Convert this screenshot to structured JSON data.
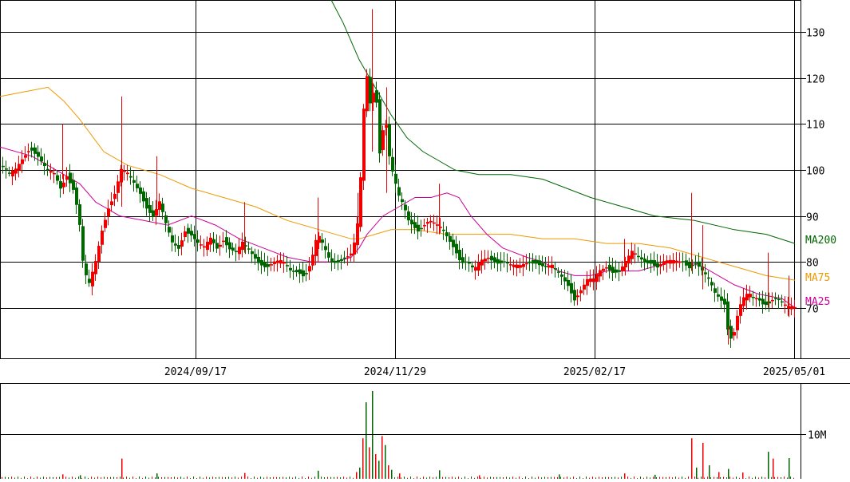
{
  "chart_data": {
    "type": "candlestick",
    "x_labels": [
      "2024/09/17",
      "2024/11/29",
      "2025/02/17",
      "2025/05/01"
    ],
    "y_ticks": [
      70,
      80,
      90,
      100,
      110,
      120,
      130
    ],
    "ylim": [
      59,
      137
    ],
    "volume_ticks": [
      {
        "value": 10000000,
        "label": "10M"
      }
    ],
    "volume_max": 19500000,
    "colors": {
      "up": "#ee0000",
      "down": "#006600",
      "ma25": "#cc0099",
      "ma75": "#ee9900",
      "ma200": "#006600",
      "grid": "#000000"
    },
    "legend": [
      {
        "name": "MA200",
        "color": "#006600"
      },
      {
        "name": "MA75",
        "color": "#ee9900"
      },
      {
        "name": "MA25",
        "color": "#cc0099"
      }
    ],
    "price_path": [
      [
        0,
        101
      ],
      [
        10,
        99
      ],
      [
        18,
        100
      ],
      [
        28,
        103
      ],
      [
        36,
        105
      ],
      [
        46,
        103
      ],
      [
        56,
        100
      ],
      [
        66,
        99
      ],
      [
        74,
        96
      ],
      [
        82,
        99
      ],
      [
        90,
        96
      ],
      [
        97,
        90
      ],
      [
        103,
        78
      ],
      [
        110,
        75
      ],
      [
        118,
        80
      ],
      [
        126,
        87
      ],
      [
        134,
        92
      ],
      [
        142,
        95
      ],
      [
        150,
        100
      ],
      [
        158,
        99
      ],
      [
        166,
        97
      ],
      [
        174,
        95
      ],
      [
        182,
        92
      ],
      [
        190,
        90
      ],
      [
        198,
        93
      ],
      [
        206,
        88
      ],
      [
        214,
        84
      ],
      [
        222,
        83
      ],
      [
        230,
        87
      ],
      [
        238,
        86
      ],
      [
        246,
        84
      ],
      [
        254,
        83
      ],
      [
        262,
        85
      ],
      [
        270,
        83
      ],
      [
        278,
        85
      ],
      [
        286,
        83
      ],
      [
        294,
        82
      ],
      [
        302,
        84
      ],
      [
        312,
        82
      ],
      [
        322,
        80
      ],
      [
        332,
        79
      ],
      [
        342,
        80
      ],
      [
        352,
        80
      ],
      [
        362,
        78
      ],
      [
        372,
        78
      ],
      [
        380,
        77
      ],
      [
        388,
        80
      ],
      [
        396,
        86
      ],
      [
        404,
        83
      ],
      [
        412,
        80
      ],
      [
        420,
        80
      ],
      [
        430,
        81
      ],
      [
        440,
        82
      ],
      [
        448,
        90
      ],
      [
        453,
        110
      ],
      [
        457,
        122
      ],
      [
        461,
        115
      ],
      [
        465,
        113
      ],
      [
        468,
        125
      ],
      [
        472,
        105
      ],
      [
        476,
        103
      ],
      [
        480,
        115
      ],
      [
        484,
        105
      ],
      [
        488,
        101
      ],
      [
        492,
        98
      ],
      [
        498,
        94
      ],
      [
        504,
        92
      ],
      [
        510,
        89
      ],
      [
        516,
        88
      ],
      [
        522,
        87
      ],
      [
        528,
        88
      ],
      [
        536,
        89
      ],
      [
        544,
        88
      ],
      [
        552,
        87
      ],
      [
        560,
        85
      ],
      [
        568,
        83
      ],
      [
        576,
        80
      ],
      [
        584,
        80
      ],
      [
        592,
        78
      ],
      [
        600,
        80
      ],
      [
        610,
        81
      ],
      [
        620,
        80
      ],
      [
        630,
        80
      ],
      [
        640,
        79
      ],
      [
        650,
        79
      ],
      [
        660,
        80
      ],
      [
        670,
        80
      ],
      [
        680,
        79
      ],
      [
        690,
        79
      ],
      [
        700,
        77
      ],
      [
        710,
        75
      ],
      [
        718,
        72
      ],
      [
        726,
        74
      ],
      [
        734,
        76
      ],
      [
        742,
        76
      ],
      [
        750,
        78
      ],
      [
        758,
        79
      ],
      [
        766,
        78
      ],
      [
        774,
        78
      ],
      [
        782,
        80
      ],
      [
        790,
        82
      ],
      [
        798,
        81
      ],
      [
        806,
        80
      ],
      [
        814,
        80
      ],
      [
        822,
        79
      ],
      [
        830,
        80
      ],
      [
        838,
        80
      ],
      [
        846,
        80
      ],
      [
        854,
        80
      ],
      [
        862,
        79
      ],
      [
        870,
        80
      ],
      [
        878,
        78
      ],
      [
        886,
        76
      ],
      [
        894,
        73
      ],
      [
        900,
        72
      ],
      [
        906,
        71
      ],
      [
        912,
        63
      ],
      [
        918,
        65
      ],
      [
        924,
        70
      ],
      [
        930,
        72
      ],
      [
        936,
        73
      ],
      [
        942,
        72
      ],
      [
        948,
        72
      ],
      [
        954,
        71
      ],
      [
        960,
        71
      ],
      [
        966,
        72
      ],
      [
        972,
        72
      ],
      [
        978,
        71
      ],
      [
        984,
        70
      ],
      [
        990,
        70
      ],
      [
        996,
        70
      ]
    ],
    "ma25": [
      [
        0,
        105
      ],
      [
        40,
        103
      ],
      [
        80,
        99
      ],
      [
        100,
        97
      ],
      [
        120,
        93
      ],
      [
        150,
        90
      ],
      [
        180,
        89
      ],
      [
        210,
        88
      ],
      [
        240,
        90
      ],
      [
        270,
        88
      ],
      [
        300,
        85
      ],
      [
        330,
        83
      ],
      [
        360,
        81
      ],
      [
        390,
        80
      ],
      [
        420,
        80
      ],
      [
        440,
        81
      ],
      [
        450,
        83
      ],
      [
        460,
        86
      ],
      [
        480,
        90
      ],
      [
        500,
        92
      ],
      [
        520,
        94
      ],
      [
        540,
        94
      ],
      [
        560,
        95
      ],
      [
        575,
        94
      ],
      [
        590,
        90
      ],
      [
        610,
        86
      ],
      [
        630,
        83
      ],
      [
        660,
        81
      ],
      [
        680,
        80
      ],
      [
        700,
        78
      ],
      [
        720,
        77
      ],
      [
        740,
        77
      ],
      [
        760,
        78
      ],
      [
        780,
        78
      ],
      [
        800,
        78
      ],
      [
        820,
        79
      ],
      [
        840,
        80
      ],
      [
        860,
        80
      ],
      [
        880,
        79
      ],
      [
        900,
        77
      ],
      [
        920,
        75
      ],
      [
        950,
        73
      ],
      [
        980,
        72
      ],
      [
        996,
        70
      ]
    ],
    "ma75": [
      [
        0,
        116
      ],
      [
        30,
        117
      ],
      [
        60,
        118
      ],
      [
        80,
        115
      ],
      [
        100,
        111
      ],
      [
        130,
        104
      ],
      [
        160,
        101
      ],
      [
        200,
        99
      ],
      [
        240,
        96
      ],
      [
        280,
        94
      ],
      [
        320,
        92
      ],
      [
        360,
        89
      ],
      [
        400,
        87
      ],
      [
        440,
        85
      ],
      [
        450,
        85
      ],
      [
        470,
        86
      ],
      [
        490,
        87
      ],
      [
        520,
        87
      ],
      [
        560,
        86
      ],
      [
        600,
        86
      ],
      [
        640,
        86
      ],
      [
        680,
        85
      ],
      [
        720,
        85
      ],
      [
        760,
        84
      ],
      [
        800,
        84
      ],
      [
        840,
        83
      ],
      [
        880,
        81
      ],
      [
        920,
        79
      ],
      [
        960,
        77
      ],
      [
        996,
        76
      ]
    ],
    "ma200": [
      [
        415,
        137
      ],
      [
        430,
        132
      ],
      [
        450,
        124
      ],
      [
        470,
        118
      ],
      [
        490,
        112
      ],
      [
        510,
        107
      ],
      [
        530,
        104
      ],
      [
        550,
        102
      ],
      [
        570,
        100
      ],
      [
        600,
        99
      ],
      [
        640,
        99
      ],
      [
        680,
        98
      ],
      [
        710,
        96
      ],
      [
        740,
        94
      ],
      [
        780,
        92
      ],
      [
        820,
        90
      ],
      [
        870,
        89
      ],
      [
        920,
        87
      ],
      [
        960,
        86
      ],
      [
        996,
        84
      ]
    ],
    "spikes": [
      [
        78,
        98,
        110
      ],
      [
        152,
        92,
        116
      ],
      [
        196,
        90,
        103
      ],
      [
        306,
        82,
        93
      ],
      [
        398,
        80,
        94
      ],
      [
        448,
        88,
        95
      ],
      [
        466,
        104,
        135
      ],
      [
        484,
        95,
        118
      ],
      [
        550,
        86,
        97
      ],
      [
        782,
        78,
        85
      ],
      [
        866,
        78,
        95
      ],
      [
        880,
        74,
        88
      ],
      [
        962,
        70,
        82
      ],
      [
        988,
        68,
        77
      ],
      [
        912,
        62,
        66
      ]
    ],
    "volume": [
      [
        78,
        1000000
      ],
      [
        100,
        800000
      ],
      [
        152,
        4500000
      ],
      [
        196,
        1200000
      ],
      [
        306,
        1300000
      ],
      [
        398,
        1800000
      ],
      [
        446,
        1500000
      ],
      [
        450,
        2500000
      ],
      [
        454,
        9000000
      ],
      [
        458,
        17000000
      ],
      [
        462,
        7000000
      ],
      [
        466,
        19500000
      ],
      [
        470,
        5500000
      ],
      [
        474,
        4000000
      ],
      [
        478,
        9500000
      ],
      [
        482,
        7500000
      ],
      [
        486,
        3000000
      ],
      [
        490,
        2000000
      ],
      [
        500,
        1200000
      ],
      [
        550,
        1900000
      ],
      [
        600,
        800000
      ],
      [
        700,
        1000000
      ],
      [
        782,
        1200000
      ],
      [
        820,
        900000
      ],
      [
        866,
        9000000
      ],
      [
        872,
        2500000
      ],
      [
        880,
        8000000
      ],
      [
        888,
        3000000
      ],
      [
        900,
        1500000
      ],
      [
        912,
        2200000
      ],
      [
        930,
        1400000
      ],
      [
        962,
        6000000
      ],
      [
        968,
        4500000
      ],
      [
        988,
        4600000
      ]
    ]
  }
}
